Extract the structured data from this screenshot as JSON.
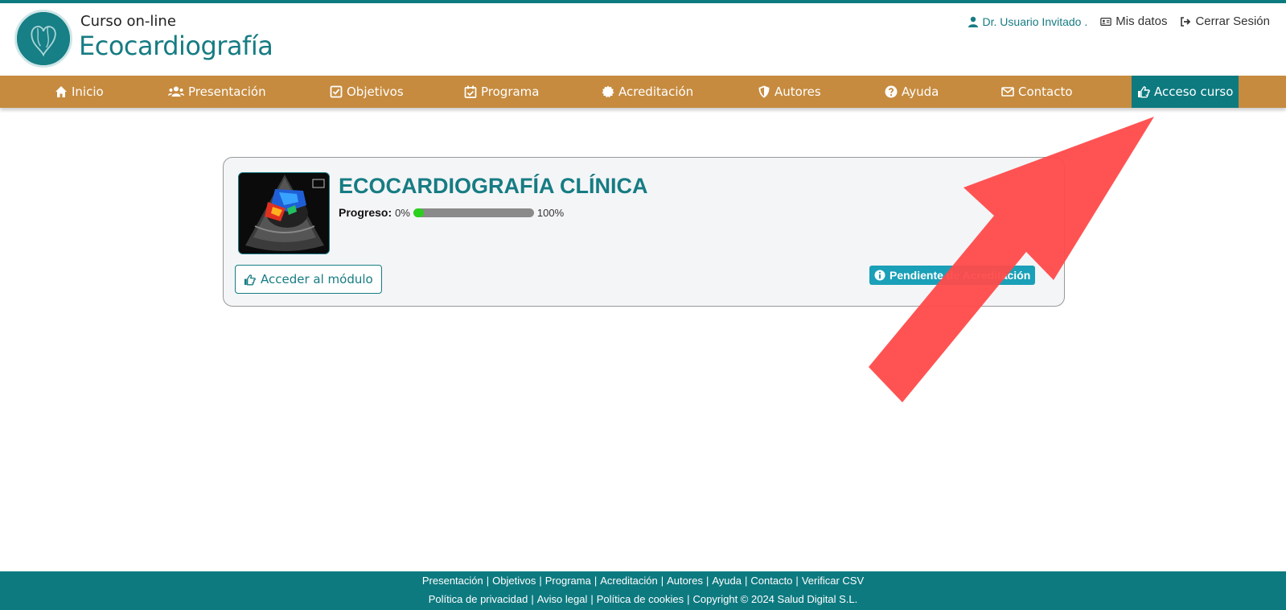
{
  "header": {
    "brand_line1": "Curso  on-line",
    "brand_line2": "Ecocardiografía",
    "user_name": "Dr. Usuario Invitado .",
    "my_data": "Mis datos",
    "logout": "Cerrar Sesión"
  },
  "nav": {
    "items": [
      {
        "label": "Inicio",
        "icon": "home-icon"
      },
      {
        "label": "Presentación",
        "icon": "users-icon"
      },
      {
        "label": "Objetivos",
        "icon": "checkbox-icon"
      },
      {
        "label": "Programa",
        "icon": "calendar-check-icon"
      },
      {
        "label": "Acreditación",
        "icon": "badge-icon"
      },
      {
        "label": "Autores",
        "icon": "shield-icon"
      },
      {
        "label": "Ayuda",
        "icon": "help-icon"
      },
      {
        "label": "Contacto",
        "icon": "envelope-icon"
      },
      {
        "label": "Acceso curso",
        "icon": "pointing-hand-icon"
      }
    ],
    "active": "Acceso curso"
  },
  "module": {
    "title": "ECOCARDIOGRAFÍA CLÍNICA",
    "progress_label": "Progreso:",
    "progress_min": "0%",
    "progress_max": "100%",
    "progress_value": 0.09,
    "access_button": "Acceder al módulo",
    "status_badge": "Pendiente de Acreditación"
  },
  "footer": {
    "line1": [
      "Presentación",
      "Objetivos",
      "Programa",
      "Acreditación",
      "Autores",
      "Ayuda",
      "Contacto",
      "Verificar CSV"
    ],
    "line2": [
      "Política de privacidad",
      "Aviso legal",
      "Política de cookies",
      "Copyright © 2024 Salud Digital S.L."
    ]
  },
  "colors": {
    "teal": "#0d7a80",
    "nav_bg": "#c68b3f",
    "progress_fill": "#2ad11c",
    "badge": "#1aa0b8",
    "annotation_arrow": "#ff4a4a"
  }
}
